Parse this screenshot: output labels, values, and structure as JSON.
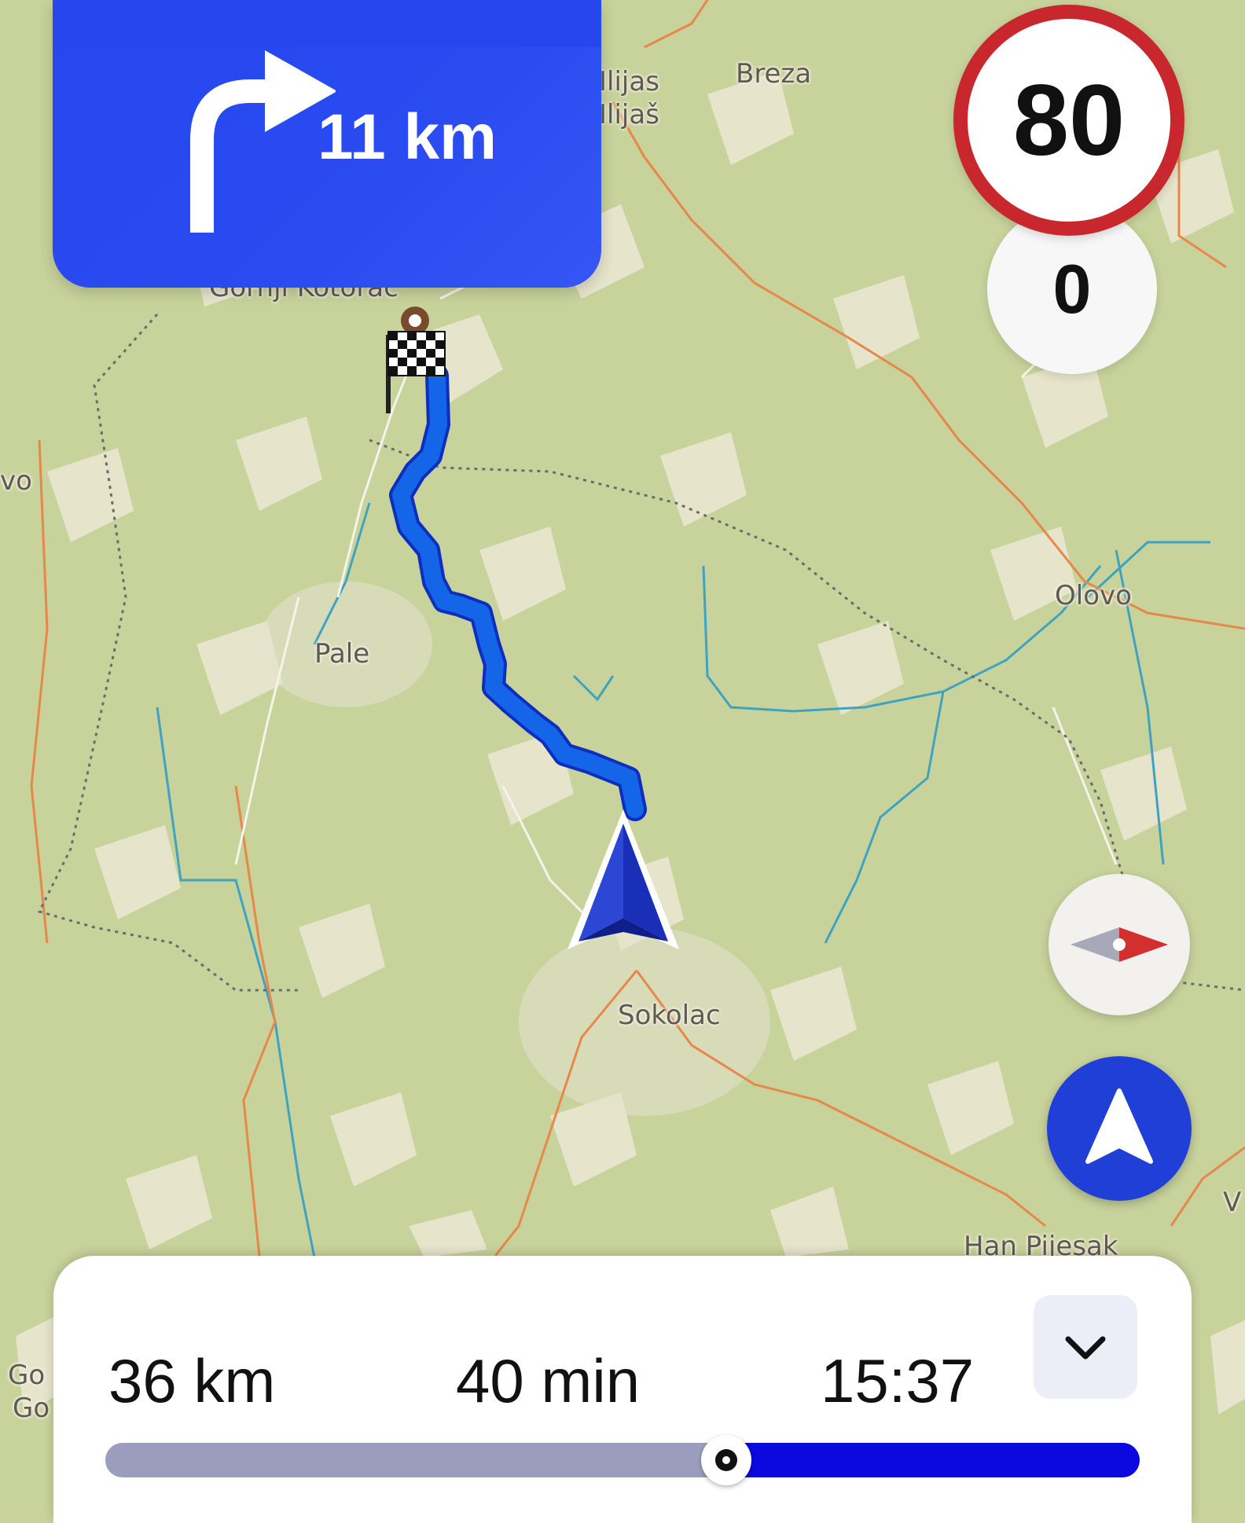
{
  "navigation": {
    "turn": {
      "icon": "turn-right-icon",
      "distance": "11 km"
    },
    "speed_limit": "80",
    "current_speed": "0"
  },
  "map": {
    "places": {
      "ilijas_1": "Ilijas",
      "ilijas_2": "Ilijaš",
      "breza": "Breza",
      "gornji_kotorac": "Gornji Kotorac",
      "vo": "vo",
      "olovo": "Olovo",
      "pale": "Pale",
      "sokolac": "Sokolac",
      "han_pijesak": "Han Pijesak",
      "go_1": "Go",
      "go_2": "Go",
      "v": "V"
    },
    "destination_icon": "checkered-flag-icon",
    "position_icon": "navigation-arrow-icon"
  },
  "controls": {
    "compass_icon": "compass-icon",
    "recenter_icon": "recenter-arrow-icon"
  },
  "trip": {
    "distance": "36 km",
    "duration": "40 min",
    "arrival": "15:37",
    "collapse_icon": "chevron-down-icon",
    "progress": 0.6
  },
  "colors": {
    "turn_card": "#2647ee",
    "speed_limit_border": "#c8272d",
    "route": "#1565e8",
    "progress_fill": "#0b08e0",
    "progress_track": "#9c9dbe",
    "recenter": "#1f3fd6"
  }
}
